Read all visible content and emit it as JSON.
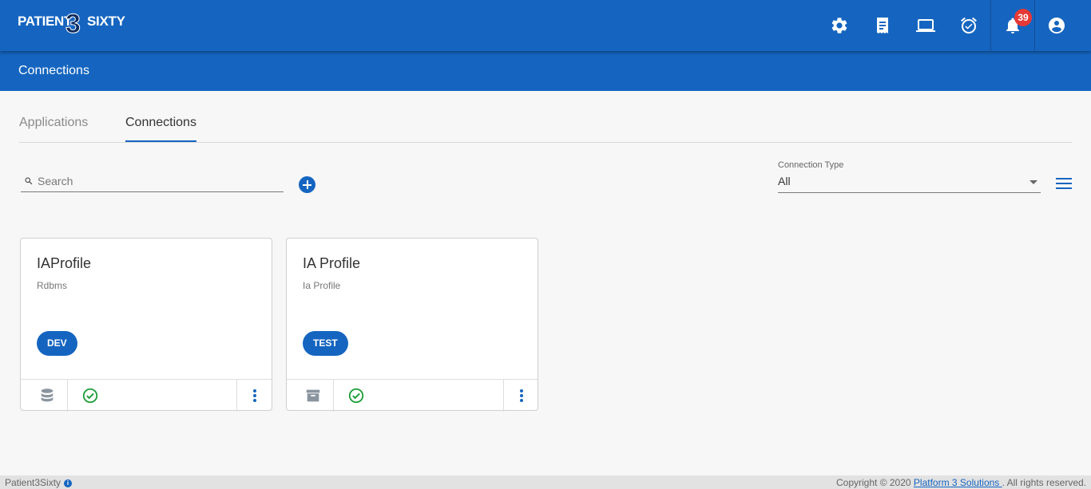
{
  "header": {
    "logo_left": "PATIENT",
    "logo_mid": "3",
    "logo_right": "SIXTY",
    "icons": [
      "gear-icon",
      "receipt-icon",
      "laptop-icon",
      "alarm-check-icon",
      "bell-icon",
      "account-circle-icon"
    ],
    "notification_count": "39"
  },
  "subheader": {
    "title": "Connections"
  },
  "tabs": [
    {
      "label": "Applications",
      "active": false
    },
    {
      "label": "Connections",
      "active": true
    }
  ],
  "toolbar": {
    "search_placeholder": "Search",
    "connection_type_label": "Connection Type",
    "connection_type_value": "All"
  },
  "cards": [
    {
      "title": "IAProfile",
      "subtitle": "Rdbms",
      "env": "DEV",
      "type_icon": "database-icon",
      "status_icon": "check-circle-icon"
    },
    {
      "title": "IA Profile",
      "subtitle": "Ia Profile",
      "env": "TEST",
      "type_icon": "archive-icon",
      "status_icon": "check-circle-icon"
    }
  ],
  "footer": {
    "app_name": "Patient3Sixty",
    "info": "i",
    "copyright_prefix": "Copyright © 2020",
    "company_link": "Platform 3 Solutions ",
    "copyright_suffix": ". All rights reserved."
  },
  "colors": {
    "primary": "#1565c0",
    "badge": "#e53935",
    "success": "#1e9e3a",
    "footer_bg": "#e2e2e2"
  }
}
